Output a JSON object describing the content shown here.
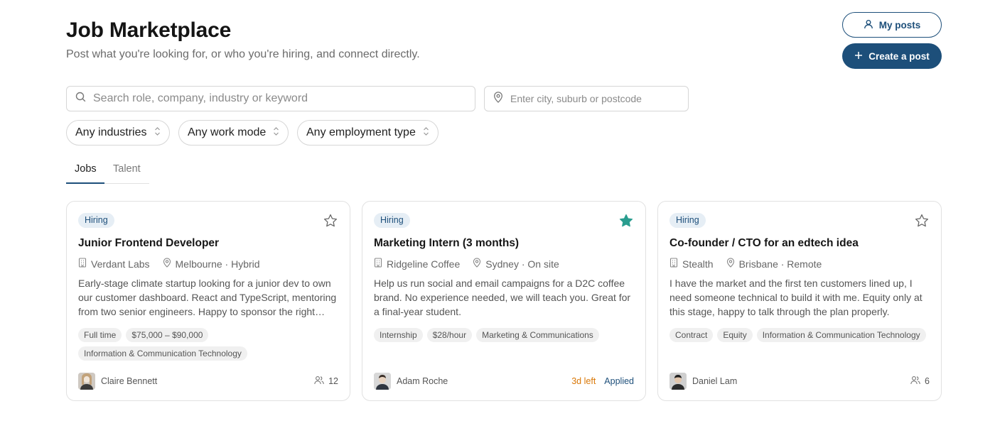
{
  "header": {
    "title": "Job Marketplace",
    "subtitle": "Post what you're looking for, or who you're hiring, and connect directly.",
    "my_posts_label": "My posts",
    "create_post_label": "Create a post"
  },
  "search": {
    "placeholder": "Search role, company, industry or keyword",
    "location_placeholder": "Enter city, suburb or postcode"
  },
  "filters": {
    "industries": "Any industries",
    "work_mode": "Any work mode",
    "employment_type": "Any employment type"
  },
  "tabs": {
    "jobs": "Jobs",
    "talent": "Talent",
    "active": "Jobs"
  },
  "colors": {
    "accent": "#1d4f7a",
    "star_active": "#2a9d8f",
    "days_left": "#d97706"
  },
  "cards": [
    {
      "badge": "Hiring",
      "starred": false,
      "title": "Junior Frontend Developer",
      "company": "Verdant Labs",
      "location": "Melbourne · Hybrid",
      "description": "Early-stage climate startup looking for a junior dev to own our customer dashboard. React and TypeScript, mentoring from two senior engineers. Happy to sponsor the right candidate.",
      "chips": [
        "Full time",
        "$75,000 – $90,000",
        "Information & Communication Technology"
      ],
      "poster": "Claire Bennett",
      "applicants": "12"
    },
    {
      "badge": "Hiring",
      "starred": true,
      "title": "Marketing Intern (3 months)",
      "company": "Ridgeline Coffee",
      "location": "Sydney · On site",
      "description": "Help us run social and email campaigns for a D2C coffee brand. No experience needed, we will teach you. Great for a final-year student.",
      "chips": [
        "Internship",
        "$28/hour",
        "Marketing & Communications"
      ],
      "poster": "Adam Roche",
      "days_left": "3d left",
      "applied": "Applied"
    },
    {
      "badge": "Hiring",
      "starred": false,
      "title": "Co-founder / CTO for an edtech idea",
      "company": "Stealth",
      "location": "Brisbane · Remote",
      "description": "I have the market and the first ten customers lined up, I need someone technical to build it with me. Equity only at this stage, happy to talk through the plan properly.",
      "chips": [
        "Contract",
        "Equity",
        "Information & Communication Technology"
      ],
      "poster": "Daniel Lam",
      "applicants": "6"
    }
  ]
}
